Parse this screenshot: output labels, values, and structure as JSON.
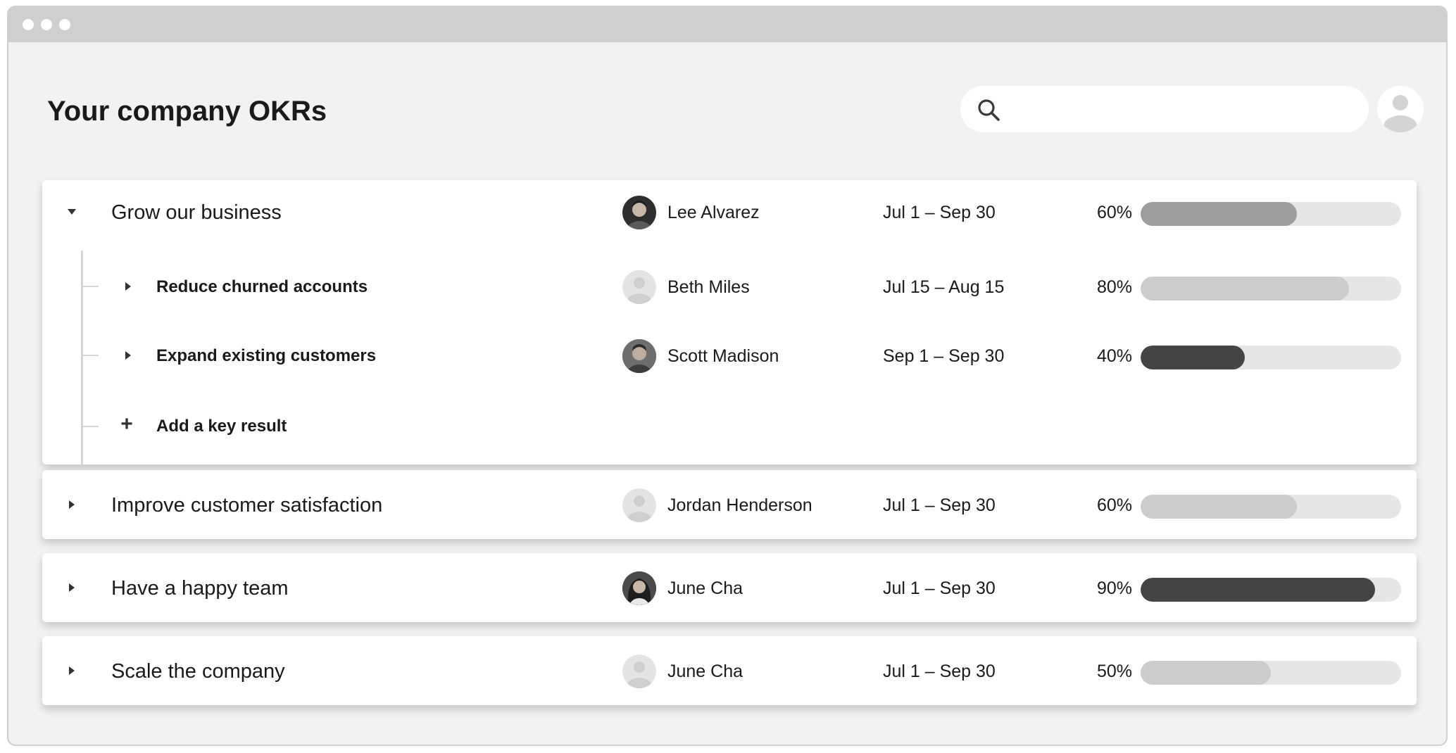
{
  "page": {
    "title": "Your company OKRs"
  },
  "search": {
    "placeholder": ""
  },
  "icons": {
    "caret_expanded": "caret-down-icon",
    "caret_collapsed": "caret-right-icon",
    "search": "search-icon",
    "add": "plus-icon",
    "profile": "user-icon"
  },
  "colors": {
    "window_bg": "#f2f2f2",
    "titlebar": "#cfcfcf",
    "track": "#e6e6e6",
    "fill_medium": "#9e9e9e",
    "fill_light": "#cccccc",
    "fill_dark": "#444444"
  },
  "objectives": [
    {
      "title": "Grow our business",
      "owner": "Lee Alvarez",
      "dates": "Jul 1 – Sep 30",
      "progress_label": "60%",
      "progress": 0.6,
      "expanded": true,
      "key_results": [
        {
          "title": "Reduce churned accounts",
          "owner": "Beth Miles",
          "dates": "Jul 15 – Aug 15",
          "progress_label": "80%",
          "progress": 0.8
        },
        {
          "title": "Expand existing customers",
          "owner": "Scott Madison",
          "dates": "Sep 1 – Sep 30",
          "progress_label": "40%",
          "progress": 0.4
        }
      ],
      "add_key_result_label": "Add a key result"
    },
    {
      "title": "Improve customer satisfaction",
      "owner": "Jordan Henderson",
      "dates": "Jul 1 – Sep 30",
      "progress_label": "60%",
      "progress": 0.6
    },
    {
      "title": "Have a happy team",
      "owner": "June Cha",
      "dates": "Jul 1 – Sep 30",
      "progress_label": "90%",
      "progress": 0.9
    },
    {
      "title": "Scale the company",
      "owner": "June Cha",
      "dates": "Jul 1 – Sep 30",
      "progress_label": "50%",
      "progress": 0.5
    }
  ]
}
